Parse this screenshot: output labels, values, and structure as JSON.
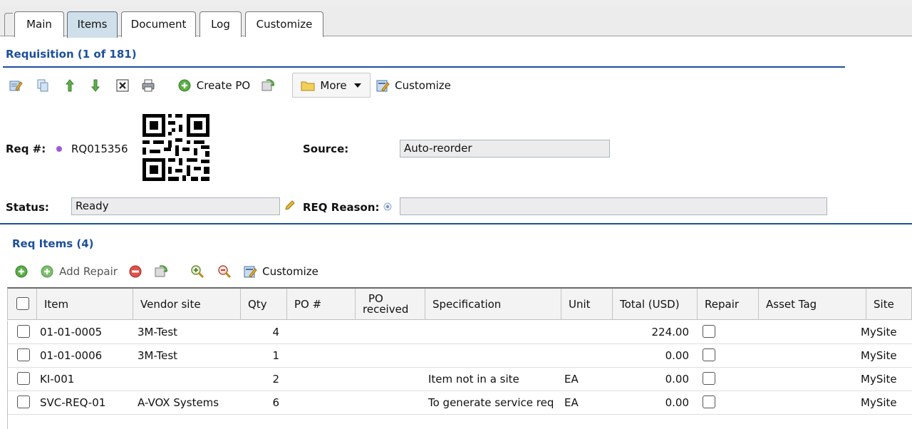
{
  "tabs": [
    {
      "label": "Main",
      "active": false
    },
    {
      "label": "Items",
      "active": true
    },
    {
      "label": "Document",
      "active": false
    },
    {
      "label": "Log",
      "active": false
    },
    {
      "label": "Customize",
      "active": false
    }
  ],
  "requisition": {
    "title": "Requisition (1 of 181)",
    "toolbar": {
      "create_po_label": "Create PO",
      "more_label": "More",
      "customize_label": "Customize"
    },
    "req_number_label": "Req #:",
    "req_number_value": "RQ015356",
    "source_label": "Source:",
    "source_value": "Auto-reorder",
    "status_label": "Status:",
    "status_value": "Ready",
    "reason_label": "REQ Reason:",
    "reason_value": ""
  },
  "req_items": {
    "title": "Req Items (4)",
    "toolbar": {
      "add_repair_label": "Add Repair",
      "customize_label": "Customize"
    },
    "columns": {
      "item": "Item",
      "vendor_site": "Vendor site",
      "qty": "Qty",
      "po_number": "PO #",
      "po_received_1": "PO",
      "po_received_2": "received",
      "specification": "Specification",
      "unit": "Unit",
      "total": "Total (USD)",
      "repair": "Repair",
      "asset_tag": "Asset Tag",
      "site": "Site"
    },
    "rows": [
      {
        "item": "01-01-0005",
        "vendor_site": "3M-Test",
        "qty": "4",
        "po_number": "",
        "po_received": "",
        "specification": "",
        "unit": "",
        "total": "224.00",
        "asset_tag": "",
        "site": "MySite"
      },
      {
        "item": "01-01-0006",
        "vendor_site": "3M-Test",
        "qty": "1",
        "po_number": "",
        "po_received": "",
        "specification": "",
        "unit": "",
        "total": "0.00",
        "asset_tag": "",
        "site": "MySite"
      },
      {
        "item": "KI-001",
        "vendor_site": "",
        "qty": "2",
        "po_number": "",
        "po_received": "",
        "specification": "Item not in a site",
        "unit": "EA",
        "total": "0.00",
        "asset_tag": "",
        "site": "MySite"
      },
      {
        "item": "SVC-REQ-01",
        "vendor_site": "A-VOX Systems",
        "qty": "6",
        "po_number": "",
        "po_received": "",
        "specification": "To generate service req",
        "unit": "EA",
        "total": "0.00",
        "asset_tag": "",
        "site": "MySite"
      }
    ]
  },
  "colors": {
    "accent": "#1c4f9c",
    "active_tab": "#cfe0ea",
    "field_bg": "#ececec",
    "header_bg": "#f3f3f3"
  },
  "icons": [
    "edit-icon",
    "copy-icon",
    "arrow-up-icon",
    "arrow-down-icon",
    "delete-icon",
    "print-icon",
    "add-circle-icon",
    "refresh-icon",
    "folder-icon",
    "chevron-down-icon",
    "customize-icon",
    "barcode-icon",
    "pencil-icon",
    "info-dot-icon",
    "remove-circle-icon",
    "zoom-in-icon",
    "zoom-out-icon"
  ]
}
